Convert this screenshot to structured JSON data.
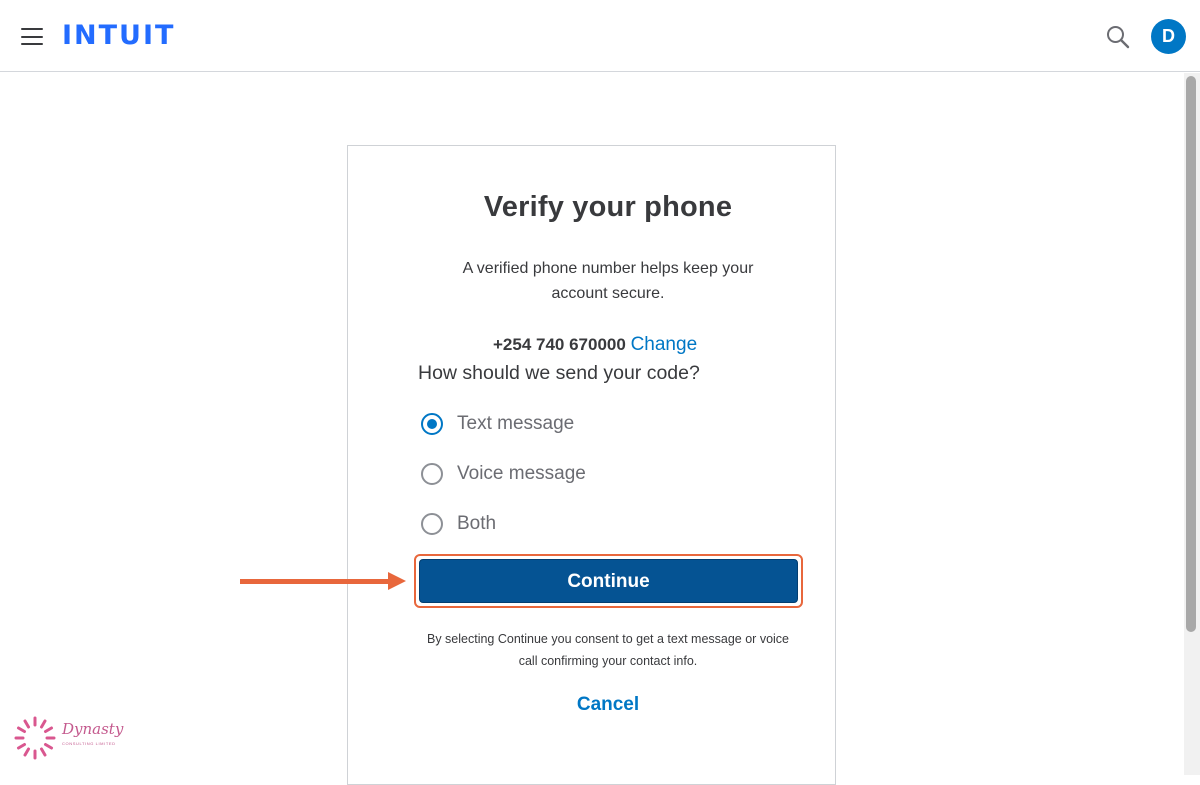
{
  "header": {
    "logo_text": "INTUIT",
    "avatar_initial": "D"
  },
  "card": {
    "title": "Verify your phone",
    "subtitle": "A verified phone number helps keep your account secure.",
    "phone_number": "+254 740 670000",
    "change_label": "Change",
    "question": "How should we send your code?",
    "options": [
      {
        "label": "Text message",
        "checked": true
      },
      {
        "label": "Voice message",
        "checked": false
      },
      {
        "label": "Both",
        "checked": false
      }
    ],
    "continue_label": "Continue",
    "consent_text": "By selecting Continue you consent to get a text message or voice call confirming your contact info.",
    "cancel_label": "Cancel"
  },
  "watermark": {
    "name": "Dynasty",
    "tagline": "CONSULTING LIMITED"
  },
  "colors": {
    "brand_blue": "#236cff",
    "link_blue": "#0077c5",
    "button_blue": "#055393",
    "annotation_orange": "#e8673c"
  },
  "icons": [
    "hamburger-menu-icon",
    "search-icon",
    "annotation-arrow",
    "watermark-logo-icon"
  ]
}
